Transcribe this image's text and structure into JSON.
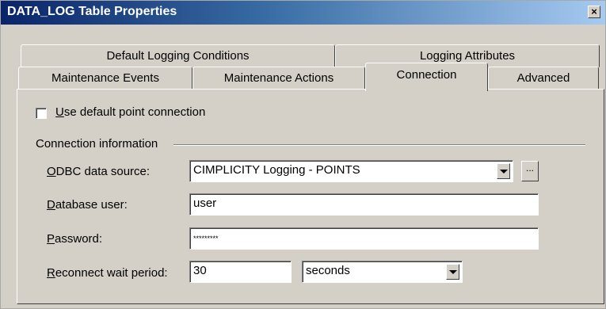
{
  "window": {
    "title": "DATA_LOG Table Properties",
    "close_glyph": "×"
  },
  "tabs": {
    "row1": [
      "Default Logging Conditions",
      "Logging Attributes"
    ],
    "row2": [
      "Maintenance Events",
      "Maintenance Actions",
      "Connection",
      "Advanced"
    ],
    "active": "Connection"
  },
  "connection": {
    "use_default_checkbox": {
      "label_accel": "U",
      "label_rest": "se default point connection",
      "checked": false
    },
    "group_title": "Connection information",
    "odbc_label_accel": "O",
    "odbc_label_rest": "DBC data source:",
    "odbc_value": "CIMPLICITY Logging - POINTS",
    "browse_label": "...",
    "db_user_label_accel": "D",
    "db_user_label_rest": "atabase user:",
    "db_user_value": "user",
    "password_label_accel": "P",
    "password_label_rest": "assword:",
    "password_value": "*********",
    "reconnect_label_accel": "R",
    "reconnect_label_rest": "econnect wait period:",
    "reconnect_value": "30",
    "reconnect_unit": "seconds"
  }
}
